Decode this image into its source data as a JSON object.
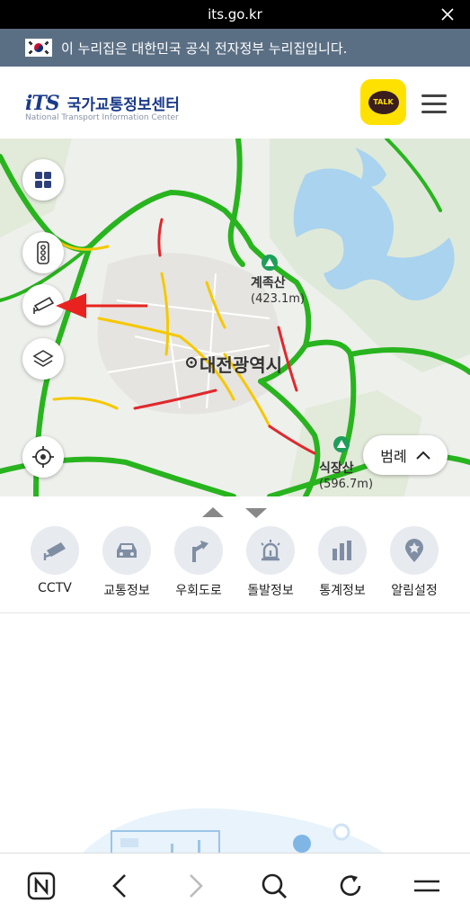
{
  "topbar": {
    "url": "its.go.kr"
  },
  "gov_banner": {
    "text": "이 누리집은 대한민국 공식 전자정부 누리집입니다."
  },
  "header": {
    "logo_mark": "iTS",
    "logo_ko": "국가교통정보센터",
    "logo_en": "National Transport Information Center",
    "kakao_label": "TALK"
  },
  "map": {
    "city_label": "대전광역시",
    "peak1_name": "계족산",
    "peak1_height": "(423.1m)",
    "peak2_name": "식장산",
    "peak2_height": "(596.7m)",
    "legend_label": "범례",
    "road_colors": {
      "free": "#28b41e",
      "slow": "#f5c800",
      "jam": "#e0282d"
    }
  },
  "menu": {
    "items": [
      {
        "label": "CCTV",
        "icon": "cctv-icon"
      },
      {
        "label": "교통정보",
        "icon": "car-icon"
      },
      {
        "label": "우회도로",
        "icon": "detour-icon"
      },
      {
        "label": "돌발정보",
        "icon": "alert-siren-icon"
      },
      {
        "label": "통계정보",
        "icon": "bar-chart-icon"
      },
      {
        "label": "알림설정",
        "icon": "notification-pin-icon"
      }
    ]
  }
}
